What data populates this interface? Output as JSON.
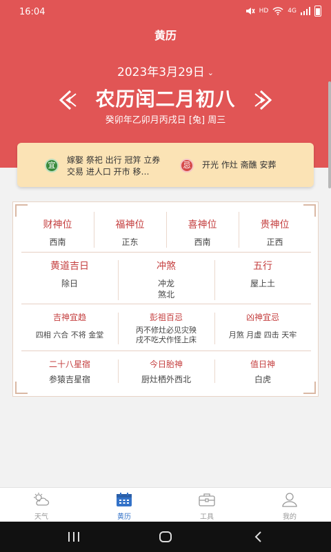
{
  "status_bar": {
    "time": "16:04",
    "network": "HD",
    "signal_type": "4G"
  },
  "app": {
    "title": "黄历"
  },
  "date_selector": {
    "label": "2023年3月29日"
  },
  "lunar": {
    "date": "农历闰二月初八",
    "ganzhi": "癸卯年乙卯月丙戌日 [兔] 周三"
  },
  "yiji": {
    "yi_badge": "宜",
    "yi_text": "嫁娶 祭祀 出行 冠笄 立券 交易 进人口 开市 移…",
    "ji_badge": "忌",
    "ji_text": "开光 作灶 斋醮 安葬"
  },
  "gods": [
    {
      "title": "财神位",
      "value": "西南"
    },
    {
      "title": "福神位",
      "value": "正东"
    },
    {
      "title": "喜神位",
      "value": "西南"
    },
    {
      "title": "贵神位",
      "value": "正西"
    }
  ],
  "row2": [
    {
      "title": "黄道吉日",
      "value": "除日"
    },
    {
      "title": "冲煞",
      "value": "冲龙",
      "value2": "煞北"
    },
    {
      "title": "五行",
      "value": "屋上土"
    }
  ],
  "row3": [
    {
      "title": "吉神宜趋",
      "value": "四相 六合 不将 金堂"
    },
    {
      "title": "彭祖百忌",
      "value": "丙不修灶必见灾殃",
      "value2": "戌不吃犬作怪上床"
    },
    {
      "title": "凶神宜忌",
      "value": "月煞 月虚 四击 天牢"
    }
  ],
  "row4": [
    {
      "title": "二十八星宿",
      "value": "参猿吉星宿"
    },
    {
      "title": "今日胎神",
      "value": "厨灶栖外西北"
    },
    {
      "title": "值日神",
      "value": "白虎"
    }
  ],
  "bottom_nav": [
    {
      "label": "天气",
      "icon": "weather-icon"
    },
    {
      "label": "黄历",
      "icon": "calendar-icon",
      "active": true
    },
    {
      "label": "工具",
      "icon": "toolbox-icon"
    },
    {
      "label": "我的",
      "icon": "user-icon"
    }
  ],
  "colors": {
    "header": "#e15555",
    "accent": "#c43e3e",
    "card": "#fbe3b5",
    "active_tab": "#3372c8"
  }
}
